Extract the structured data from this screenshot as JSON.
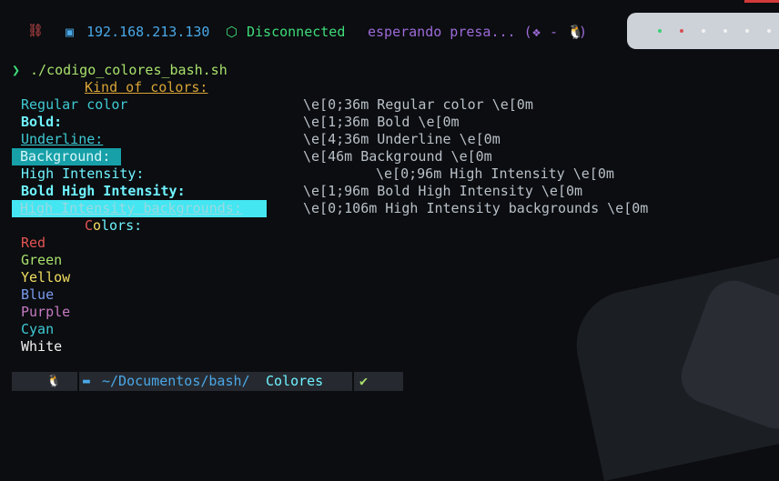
{
  "colors": {
    "bg": "#0b0d10",
    "text": "#b9c0c8",
    "cyan": "#3fc9d4",
    "bright_cyan": "#6ff3ff",
    "red": "#e35454",
    "green": "#a8e06c",
    "yellow": "#f2de62",
    "blue": "#7c9cf0",
    "purple": "#c47ac2",
    "white": "#f2f2f2",
    "orange": "#d9a437",
    "bar_blue": "#4aa8e8",
    "bar_green": "#3fdc7a",
    "bar_purple": "#9d6ad8"
  },
  "topbar": {
    "net_icon": "network-icon",
    "ip_icon": "monitor-icon",
    "ip": "192.168.213.130",
    "vpn_icon": "cube-icon",
    "vpn_status": "Disconnected",
    "target": "esperando presa... (",
    "target_icons": "❖ - ",
    "target_close": ")",
    "linux_icon": "tux-icon"
  },
  "terminal": {
    "prompt_arrow": "❯",
    "command": "./codigo_colores_bash.sh",
    "header": "Kind of colors:",
    "kinds": [
      {
        "label": "Regular color",
        "colon": "",
        "code": "\\e[0;36m Regular color \\e[0m"
      },
      {
        "label": "Bold:",
        "code": "\\e[1;36m Bold \\e[0m"
      },
      {
        "label": "Underline:",
        "code": "\\e[4;36m Underline \\e[0m"
      },
      {
        "label": " Background:",
        "code": "\\e[46m Background \\e[0m"
      },
      {
        "label": "High Intensity:",
        "code": "\\e[0;96m High Intensity \\e[0m"
      },
      {
        "label": "Bold High Intensity:",
        "code": "\\e[1;96m Bold High Intensity \\e[0m"
      },
      {
        "label": "High Intensity backgrounds:",
        "code": "\\e[0;106m High Intensity backgrounds \\e[0m"
      }
    ],
    "colors_header_c": "C",
    "colors_header_o": "o",
    "colors_header_rest": "lors:",
    "color_names": [
      "Red",
      "Green",
      "Yellow",
      "Blue",
      "Purple",
      "Cyan",
      "White"
    ]
  },
  "promptbar": {
    "os_icon": "tux-icon",
    "folder_icon": "folder-icon",
    "path_prefix": "~/Documentos/bash/",
    "path_current": "Colores",
    "status": "✔"
  }
}
